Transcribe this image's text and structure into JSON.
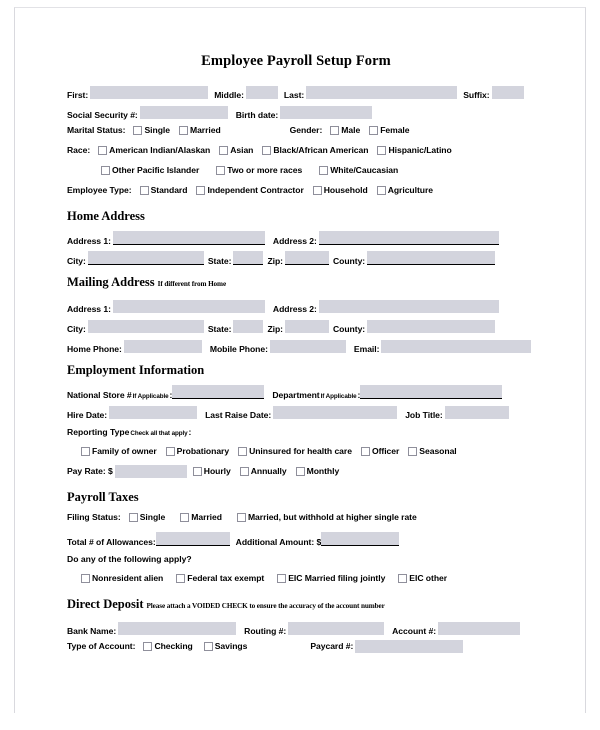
{
  "document": {
    "title": "Employee Payroll Setup Form"
  },
  "personal": {
    "first_label": "First:",
    "middle_label": "Middle:",
    "last_label": "Last:",
    "suffix_label": "Suffix:",
    "ssn_label": "Social Security #:",
    "birth_date_label": "Birth date:",
    "marital_status_label": "Marital Status:",
    "marital_options": [
      "Single",
      "Married"
    ],
    "gender_label": "Gender:",
    "gender_options": [
      "Male",
      "Female"
    ],
    "race_label": "Race:",
    "race_options_row1": [
      "American Indian/Alaskan",
      "Asian",
      "Black/African American",
      "Hispanic/Latino"
    ],
    "race_options_row2": [
      "Other Pacific Islander",
      "Two or more races",
      "White/Caucasian"
    ],
    "employee_type_label": "Employee Type:",
    "employee_type_options": [
      "Standard",
      "Independent Contractor",
      "Household",
      "Agriculture"
    ]
  },
  "home_address": {
    "heading": "Home Address",
    "address1_label": "Address 1:",
    "address2_label": "Address 2:",
    "city_label": "City:",
    "state_label": "State:",
    "zip_label": "Zip:",
    "county_label": "County:"
  },
  "mailing_address": {
    "heading": "Mailing Address",
    "heading_note": "If different from Home",
    "address1_label": "Address 1:",
    "address2_label": "Address 2:",
    "city_label": "City:",
    "state_label": "State:",
    "zip_label": "Zip:",
    "county_label": "County:",
    "home_phone_label": "Home Phone:",
    "mobile_phone_label": "Mobile Phone:",
    "email_label": "Email:"
  },
  "employment": {
    "heading": "Employment Information",
    "national_store_label": "National Store #",
    "national_store_note": "If Applicable",
    "national_store_colon": ":",
    "department_label": "Department",
    "department_note": "If Applicable",
    "department_colon": ":",
    "hire_date_label": "Hire Date:",
    "last_raise_label": "Last Raise Date:",
    "job_title_label": "Job Title:",
    "reporting_type_label": "Reporting Type",
    "reporting_type_note": "Check all that apply",
    "reporting_type_colon": ":",
    "reporting_options": [
      "Family of owner",
      "Probationary",
      "Uninsured for health care",
      "Officer",
      "Seasonal"
    ],
    "pay_rate_label": "Pay Rate: $",
    "pay_rate_options": [
      "Hourly",
      "Annually",
      "Monthly"
    ]
  },
  "payroll_taxes": {
    "heading": "Payroll Taxes",
    "filing_status_label": "Filing Status:",
    "filing_options": [
      "Single",
      "Married",
      "Married, but withhold at higher single rate"
    ],
    "allowances_label": "Total # of Allowances:",
    "additional_amount_label": "Additional Amount: $",
    "apply_question": "Do any of the following apply?",
    "apply_options": [
      "Nonresident alien",
      "Federal tax exempt",
      "EIC Married filing jointly",
      "EIC other"
    ]
  },
  "direct_deposit": {
    "heading": "Direct Deposit",
    "heading_note": "Please attach a VOIDED CHECK to ensure the accuracy of the account number",
    "bank_name_label": "Bank Name:",
    "routing_label": "Routing #:",
    "account_label": "Account #:",
    "account_type_label": "Type of Account:",
    "account_type_options": [
      "Checking",
      "Savings"
    ],
    "paycard_label": "Paycard #:"
  },
  "colors": {
    "field_fill": "#d3d4dd",
    "checkbox_border": "#8f8f9b",
    "page_border": "#d9d9de"
  }
}
